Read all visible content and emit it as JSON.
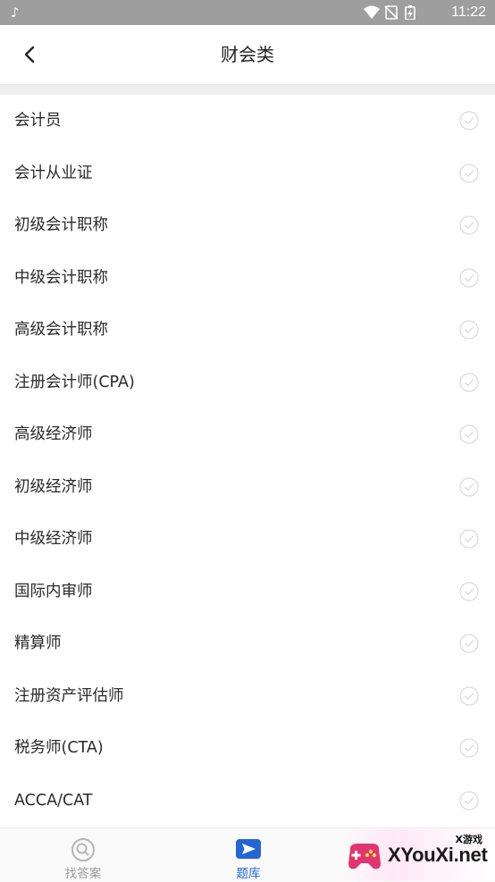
{
  "status_bar": {
    "time": "11:22",
    "app_icon": "tiktok-icon",
    "icons": [
      "wifi-icon",
      "no-sim-icon",
      "battery-charging-icon"
    ]
  },
  "nav": {
    "title": "财会类",
    "back_icon": "chevron-left-icon"
  },
  "list": {
    "items": [
      {
        "label": "会计员"
      },
      {
        "label": "会计从业证"
      },
      {
        "label": "初级会计职称"
      },
      {
        "label": "中级会计职称"
      },
      {
        "label": "高级会计职称"
      },
      {
        "label": "注册会计师(CPA)"
      },
      {
        "label": "高级经济师"
      },
      {
        "label": "初级经济师"
      },
      {
        "label": "中级经济师"
      },
      {
        "label": "国际内审师"
      },
      {
        "label": "精算师"
      },
      {
        "label": "注册资产评估师"
      },
      {
        "label": "税务师(CTA)"
      },
      {
        "label": "ACCA/CAT"
      }
    ],
    "check_icon": "check-circle-icon"
  },
  "tab_bar": {
    "tabs": [
      {
        "label": "找答案",
        "icon": "search-icon",
        "active": false
      },
      {
        "label": "题库",
        "icon": "paper-plane-icon",
        "active": true
      }
    ]
  },
  "watermark": {
    "text": "XYouXi.net",
    "sub": "X游戏"
  },
  "colors": {
    "accent": "#2465d6",
    "status_bar": "#9e9e9e",
    "separator": "#efefef"
  }
}
